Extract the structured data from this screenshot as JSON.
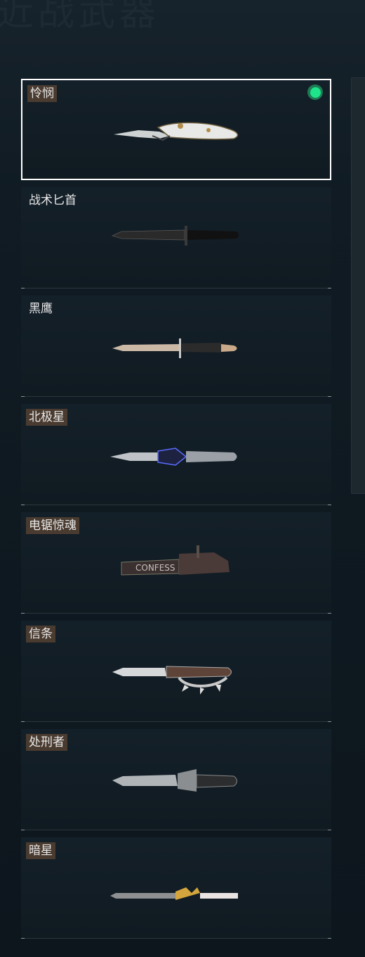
{
  "header": {
    "title": "近战武器"
  },
  "weapons": [
    {
      "name": "怜悯",
      "selected": true,
      "tagged": true,
      "equipped": true
    },
    {
      "name": "战术匕首",
      "selected": false,
      "tagged": false
    },
    {
      "name": "黑鹰",
      "selected": false,
      "tagged": false
    },
    {
      "name": "北极星",
      "selected": false,
      "tagged": true
    },
    {
      "name": "电锯惊魂",
      "selected": false,
      "tagged": true
    },
    {
      "name": "信条",
      "selected": false,
      "tagged": true
    },
    {
      "name": "处刑者",
      "selected": false,
      "tagged": true
    },
    {
      "name": "暗星",
      "selected": false,
      "tagged": true
    }
  ],
  "colors": {
    "tag_bg": "#4a3b30",
    "equipped_dot": "#1fe58a",
    "selected_border": "#ffffff"
  }
}
